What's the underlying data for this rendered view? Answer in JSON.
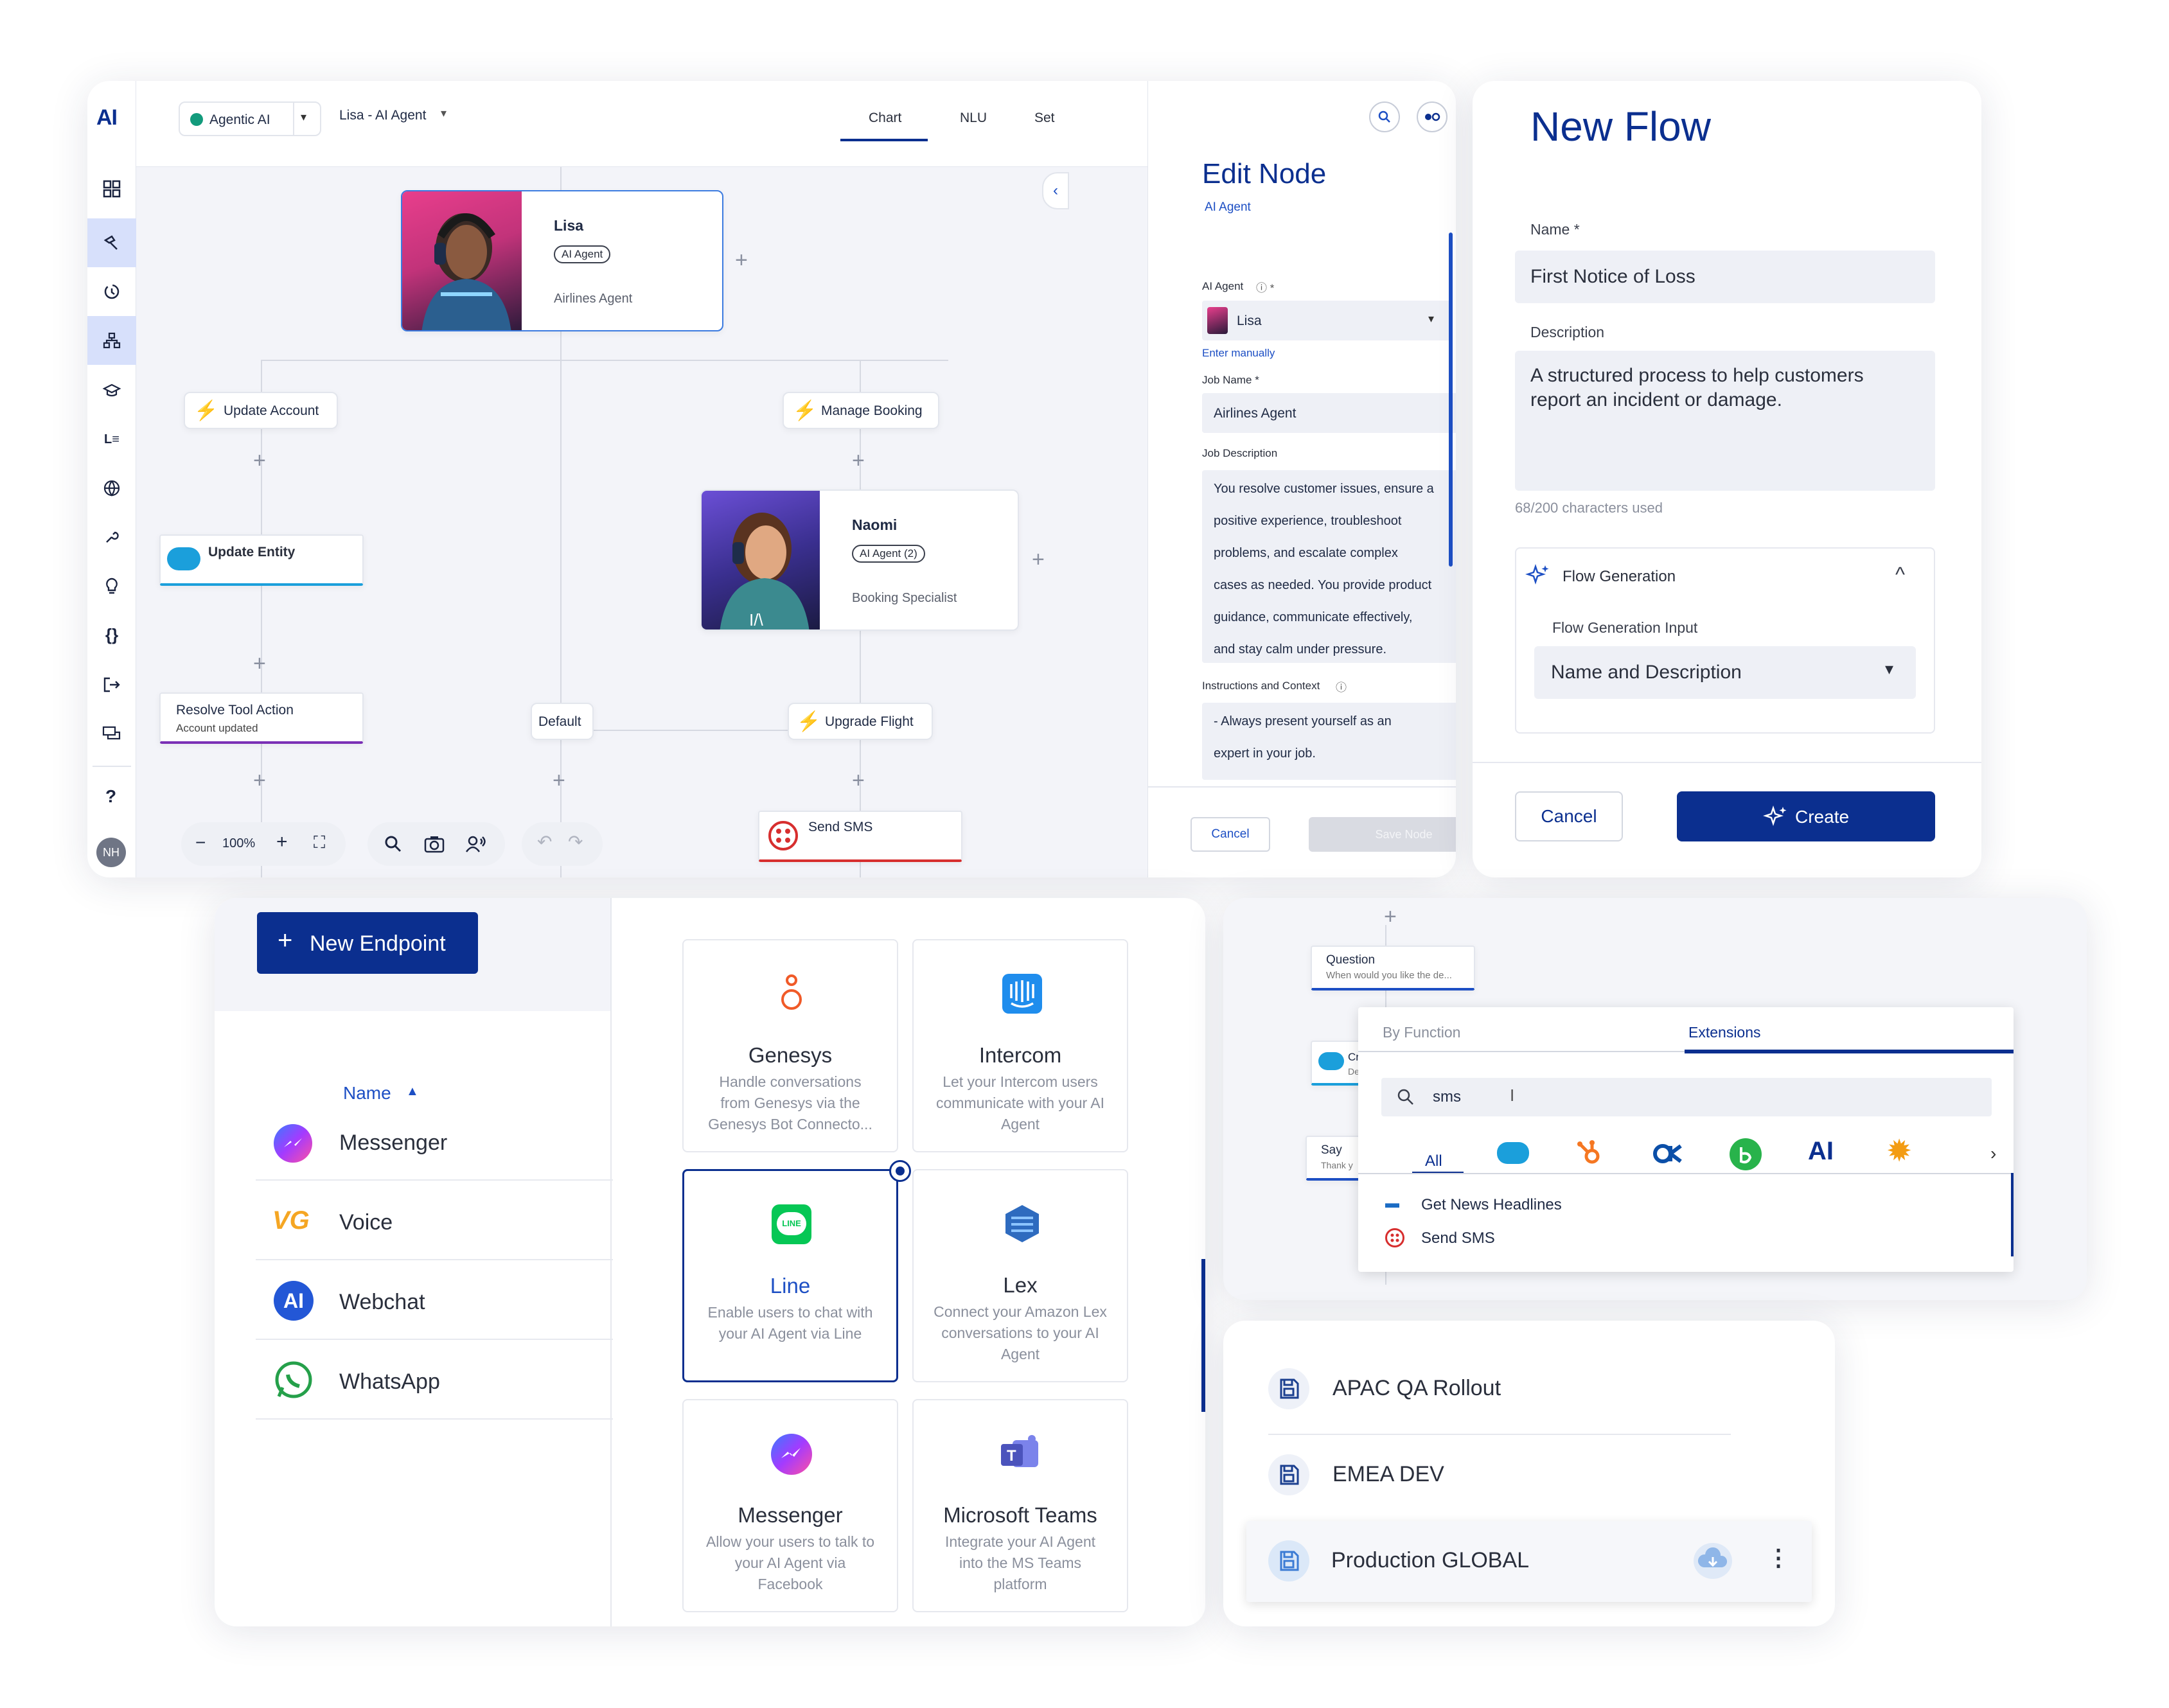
{
  "flow_editor": {
    "logo": "AI",
    "agent_select": "Agentic AI",
    "agent_name": "Lisa - AI Agent",
    "tabs": [
      "Chart",
      "NLU",
      "Set"
    ],
    "nodes": {
      "lisa": {
        "name": "Lisa",
        "badge": "AI Agent",
        "role": "Airlines Agent"
      },
      "naomi": {
        "name": "Naomi",
        "badge": "AI Agent (2)",
        "role": "Booking Specialist"
      },
      "update_account": "Update Account",
      "manage_booking": "Manage Booking",
      "update_entity": "Update Entity",
      "resolve_tool": "Resolve Tool Action",
      "resolve_sub": "Account updated",
      "default": "Default",
      "upgrade_flight": "Upgrade Flight",
      "send_sms": "Send SMS"
    },
    "zoom": "100%",
    "user_initials": "NH",
    "help": "?"
  },
  "edit_node": {
    "title": "Edit Node",
    "subtitle": "AI Agent",
    "ai_agent_label": "AI Agent",
    "ai_agent_value": "Lisa",
    "enter_manually": "Enter manually",
    "job_name_label": "Job Name *",
    "job_name_value": "Airlines Agent",
    "job_desc_label": "Job Description",
    "job_desc_lines": [
      "You resolve customer issues, ensure a",
      "positive experience, troubleshoot",
      "problems, and escalate complex",
      "cases as needed. You provide product",
      "guidance, communicate effectively,",
      "and stay calm under pressure."
    ],
    "instructions_label": "Instructions and Context",
    "instructions_lines": [
      "- Always present yourself as an",
      "expert in your job."
    ],
    "cancel": "Cancel",
    "save": "Save Node"
  },
  "new_flow": {
    "title": "New Flow",
    "name_label": "Name *",
    "name_value": "First Notice of Loss",
    "description_label": "Description",
    "description_value": "A structured process to help customers report an incident or damage.",
    "char_count": "68/200 characters used",
    "generation_title": "Flow Generation",
    "generation_input_label": "Flow Generation Input",
    "generation_input_value": "Name and Description",
    "cancel": "Cancel",
    "create": "Create"
  },
  "endpoints": {
    "new_button": "New Endpoint",
    "sort_label": "Name",
    "list": [
      {
        "name": "Messenger",
        "icon": "messenger-icon"
      },
      {
        "name": "Voice",
        "icon": "voice-gateway-icon",
        "icon_text": "VG"
      },
      {
        "name": "Webchat",
        "icon": "webchat-icon",
        "icon_text": "AI"
      },
      {
        "name": "WhatsApp",
        "icon": "whatsapp-icon"
      }
    ],
    "cards": [
      {
        "title": "Genesys",
        "desc": "Handle conversations from Genesys via the Genesys Bot Connecto..."
      },
      {
        "title": "Intercom",
        "desc": "Let your Intercom users communicate with your AI Agent"
      },
      {
        "title": "Line",
        "desc": "Enable users to chat with your AI Agent via Line"
      },
      {
        "title": "Lex",
        "desc": "Connect your Amazon Lex conversations to your AI Agent"
      },
      {
        "title": "Messenger",
        "desc": "Allow your users to talk to your AI Agent via Facebook"
      },
      {
        "title": "Microsoft Teams",
        "desc": "Integrate your AI Agent into the MS Teams platform"
      }
    ],
    "line_badge": "LINE"
  },
  "extensions": {
    "question_title": "Question",
    "question_sub": "When would you like the de...",
    "cr_title": "Cr",
    "cr_sub": "De",
    "say_title": "Say",
    "say_sub": "Thank y",
    "tabs": [
      "By Function",
      "Extensions"
    ],
    "search_value": "sms",
    "filter_all": "All",
    "filter_ai": "AI",
    "results": [
      "Get News Headlines",
      "Send SMS"
    ]
  },
  "snapshots": {
    "items": [
      "APAC QA Rollout",
      "EMEA DEV",
      "Production GLOBAL"
    ]
  },
  "colors": {
    "brand_blue": "#0b2f8f",
    "accent": "#1d4fc4",
    "salesforce": "#1b9fdb",
    "sms_red": "#d72e2e",
    "resolve_purple": "#7a2fb5"
  }
}
